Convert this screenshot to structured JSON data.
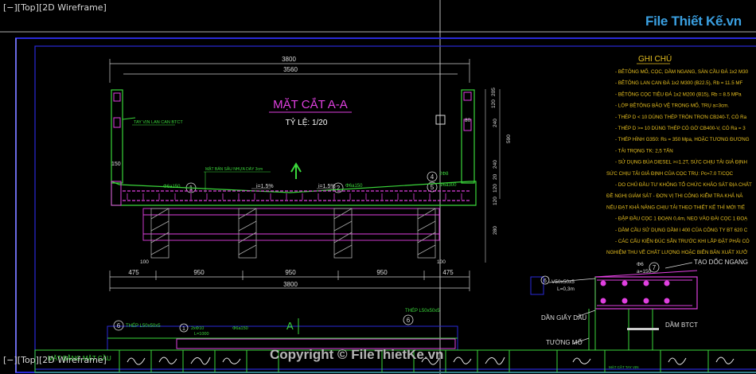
{
  "viewport": {
    "label_top": "[−][Top][2D Wireframe]",
    "label_bottom": "[−][Top][2D Wireframe]"
  },
  "watermark": {
    "logo": "File Thiết Kế.vn",
    "copyright": "Copyright © FileThietKe.vn"
  },
  "drawing": {
    "title": "MẶT CẮT A-A",
    "scale": "TỶ LỆ: 1/20",
    "dims_top": [
      "3800",
      "3560"
    ],
    "dims_bottom_segments": [
      "475",
      "950",
      "950",
      "950",
      "475"
    ],
    "dim_bottom_total": "3800",
    "dim_small_left": "100",
    "dim_small_right": "100",
    "dim_left_150": "150",
    "dims_right_vertical": [
      "205",
      "120",
      "240",
      "590",
      "240",
      "20",
      "120",
      "120",
      "280"
    ],
    "dim_right_80": "80",
    "railing_left_label": "TAY VỊN LAN CAN BTCT",
    "deck_note": "MẶT BẢN SÂU NHỰA DÀY 3cm",
    "slope_left": "i=1.5%",
    "slope_right": "i=1.5%",
    "rebar_left": "Φ6a150",
    "rebar_mid": "Φ6a150",
    "rebar_right": "Φ6a300",
    "rebar_right2": "2Φ8",
    "markers": [
      "1",
      "1",
      "2",
      "4",
      "5",
      "6",
      "6",
      "7"
    ],
    "section_mark": "A",
    "bottom_steel_left": "THÉP L50x50x5",
    "bottom_steel_right": "THÉP L50x50x5",
    "bottom_rebar_a": "2xΦ10",
    "bottom_rebar_b": "L=1000",
    "bottom_rebar_c": "Φ6a150"
  },
  "notes": {
    "heading": "GHI CHÚ",
    "lines": [
      "- BÊTÔNG MỐ, CỌC, DẦM NGANG, SÀN CẦU ĐÁ 1x2 M30",
      "- BÊTÔNG LAN CAN ĐÁ 1x2 M300 (B22.5), Rb = 11.5 MF",
      "- BÊTÔNG CỌC TIÊU ĐÁ 1x2 M200 (B15), Rb = 8.5 MPa",
      "- LỚP BÊTÔNG BẢO VỆ TRONG MỐ, TRỤ a=3cm.",
      "- THÉP D < 10 DÙNG THÉP TRÒN TRƠN CB240-T, CÓ Ra",
      "- THÉP D >= 10 DÙNG THÉP CÓ GỜ CB400-V, CÓ Ra = 3",
      "- THÉP HÌNH G350: Rs = 350 Mpa, HOẶC TƯƠNG ĐƯƠNG",
      "- TẢI TRỌNG TK: 2,5 TẤN",
      "- SỬ DỤNG BÚA DIESEL >=1.2T, SỨC CHỊU TẢI GIẢ ĐỊNH",
      "SỨC CHỊU TẢI GIẢ ĐỊNH CỦA CỌC TRỤ: Pc=7.0 T/CỌC",
      "- DO CHỦ ĐẦU TƯ KHÔNG TỔ CHỨC KHẢO SÁT ĐỊA CHẤT",
      "ĐỀ NGHỊ GIÁM SÁT - ĐƠN VỊ THI CÔNG KIỂM TRA KHẢ NĂ",
      "NẾU ĐẠT KHẢ NĂNG CHỊU TẢI THEO THIẾT KẾ THÌ MỚI TIẾ",
      "- ĐẬP ĐẦU CỌC 1 ĐOẠN 0,4m, NEO VÀO ĐÀI CỌC 1 ĐOẠ",
      "- DẦM CẦU SỬ DỤNG DẦM I 400 CỦA CÔNG TY BT 620 C",
      "- CÁC CẤU KIỆN ĐÚC SẴN TRƯỚC KHI LẮP ĐẶT PHẢI CÓ",
      "NGHIỆM THU VỀ CHẤT LƯỢNG HOẶC BIÊN BẢN XUẤT XƯỞ"
    ]
  },
  "detail": {
    "slope_label": "TẠO DỐC NGANG",
    "steel_a": "V50x50x5",
    "steel_b": "L=0,3m",
    "rebar": "Φ6",
    "spacing": "a=150",
    "felt": "DẦN GIẤY DẦU",
    "beam": "DẦM BTCT",
    "wall": "TƯỜNG MỐ"
  },
  "title_block": {
    "left_caption": "MẶT BẰNG MẶT CẦU",
    "small_caption": "MẶT CẮT TAY VỊN"
  }
}
